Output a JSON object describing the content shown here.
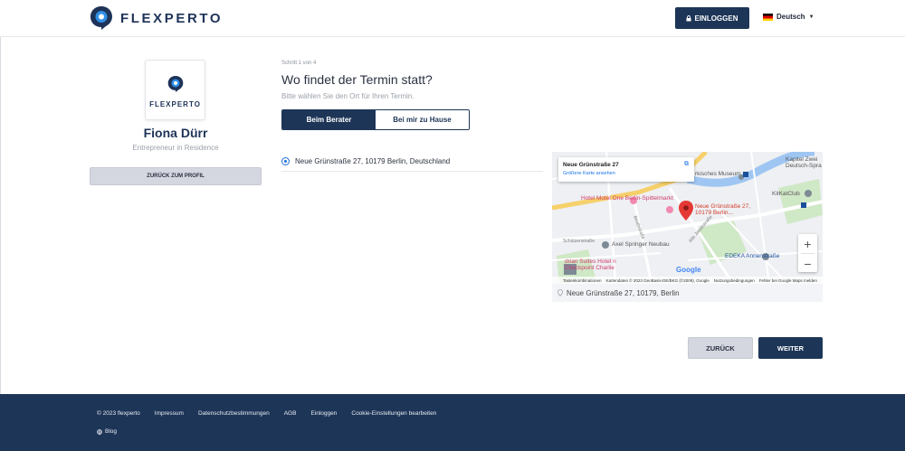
{
  "header": {
    "brand": "FLEXPERTO",
    "login_label": "EINLOGGEN",
    "language": "Deutsch"
  },
  "profile": {
    "brand": "FLEXPERTO",
    "name": "Fiona Dürr",
    "role": "Entrepreneur in Residence",
    "back_label": "ZURÜCK ZUM PROFIL"
  },
  "step": {
    "counter": "Schritt 1 von 4",
    "question": "Wo findet der Termin statt?",
    "hint": "Bitte wählen Sie den Ort für Ihren Termin.",
    "options": [
      {
        "label": "Beim Berater",
        "active": true
      },
      {
        "label": "Bei mir zu Hause",
        "active": false
      }
    ],
    "address": "Neue Grünstraße 27, 10179 Berlin, Deutschland"
  },
  "map": {
    "card_title": "Neue Grünstraße 27",
    "card_link": "Größere Karte ansehen",
    "pin_label": "Neue Grünstraße 27, 10179 Berlin...",
    "labels": {
      "hotel_motel": "Hotel Motel One Berlin-Spittelmarkt",
      "axel_springer": "Axel Springer Neubau",
      "adrian_suites": "drian Suites Hotel n Checkpoint Charlie",
      "kapitel_zwei": "Kapitel Zwei Deutsch-Spra",
      "kitkatclub": "KitKatClub",
      "edeka": "EDEKA Annenstraße",
      "maerkisches": "rkisches Museum",
      "schuetzenstrasse": "Schützenstraße",
      "beuthstrasse": "Beuthstraße",
      "alte_jakobstrasse": "Alte Jakobstraße"
    },
    "footer": {
      "shortcuts": "Tastenkombinationen",
      "attribution": "Kartendaten © 2023 GeoBasis-DE/BKG (©2009), Google",
      "terms": "Nutzungsbedingungen",
      "report": "Fehler bei Google Maps melden"
    },
    "google": "Google",
    "caption": "Neue Grünstraße 27, 10179, Berlin"
  },
  "nav": {
    "back_label": "ZURÜCK",
    "next_label": "WEITER"
  },
  "footer": {
    "copyright": "© 2023 flexperto",
    "links": [
      "Impressum",
      "Datenschutzbestimmungen",
      "AGB",
      "Einloggen",
      "Cookie-Einstellungen bearbeiten"
    ],
    "blog": "Blog"
  },
  "colors": {
    "brand_navy": "#1d3557",
    "accent_blue": "#1f6fd6",
    "page_bg": "#ffffff"
  }
}
